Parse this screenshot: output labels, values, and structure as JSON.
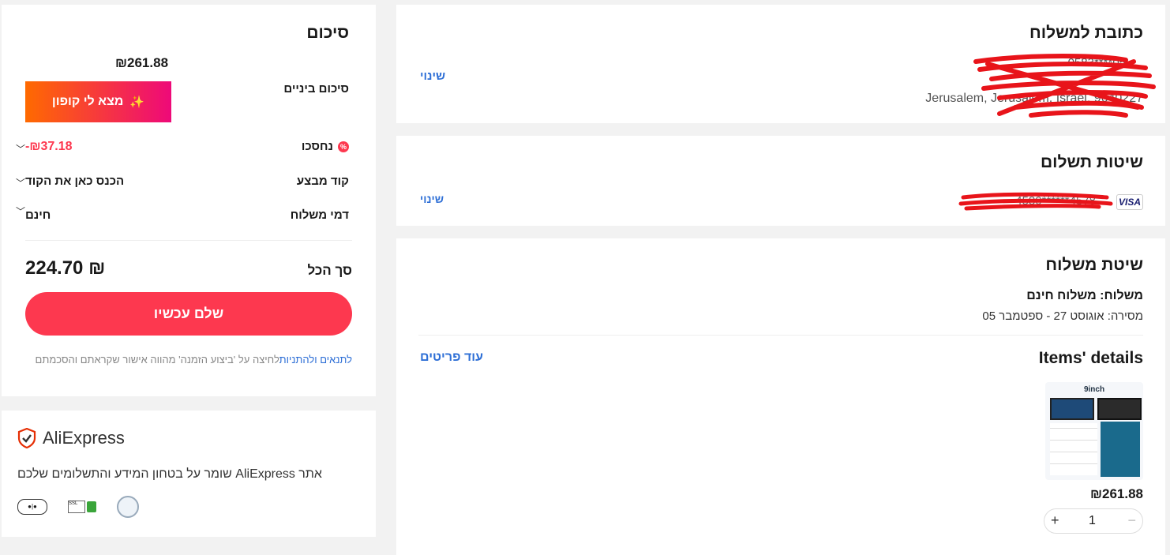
{
  "address": {
    "heading": "כתובת למשלוח",
    "line1": "0583****05",
    "line3": "Jerusalem, Jerusalem, Israel, 9640227",
    "change_label": "שינוי"
  },
  "payment": {
    "heading": "שיטות תשלום",
    "card_brand": "VISA",
    "card_masked": "4580******4578",
    "change_label": "שינוי"
  },
  "shipping": {
    "heading": "שיטת משלוח",
    "method": "משלוח: משלוח חינם",
    "delivery": "מסירה: אוגוסט 27 - ספטמבר 05"
  },
  "items": {
    "heading": "Items' details",
    "more_label": "עוד פריטים",
    "list": [
      {
        "thumb_label": "9inch",
        "price": "₪261.88",
        "qty": "1",
        "minus": "−",
        "plus": "+"
      }
    ]
  },
  "summary": {
    "heading": "סיכום",
    "subtotal_label": "סיכום ביניים",
    "subtotal_value": "₪261.88",
    "coupon_button": "מצא לי קופון",
    "savings_label": "נחסכו",
    "savings_value": "-₪37.18",
    "promo_label": "קוד מבצע",
    "promo_value": "הכנס כאן את הקוד",
    "shipping_label": "דמי משלוח",
    "shipping_value": "חינם",
    "total_label": "סך הכל",
    "total_value": "₪ 224.70",
    "pay_button": "שלם עכשיו",
    "terms_link": "לתנאים ולהתניות",
    "terms_text": "לחיצה על 'ביצוע הזמנה' מהווה אישור שקראתם והסכמתם"
  },
  "security": {
    "brand": "AliExpress",
    "text": "אתר AliExpress שומר על בטחון המידע והתשלומים שלכם"
  },
  "colors": {
    "accent_red": "#fd384f",
    "savings_red": "#fd384f",
    "link_blue": "#2e6fd6",
    "coupon_start": "#ff6a00",
    "coupon_end": "#ee0979"
  }
}
